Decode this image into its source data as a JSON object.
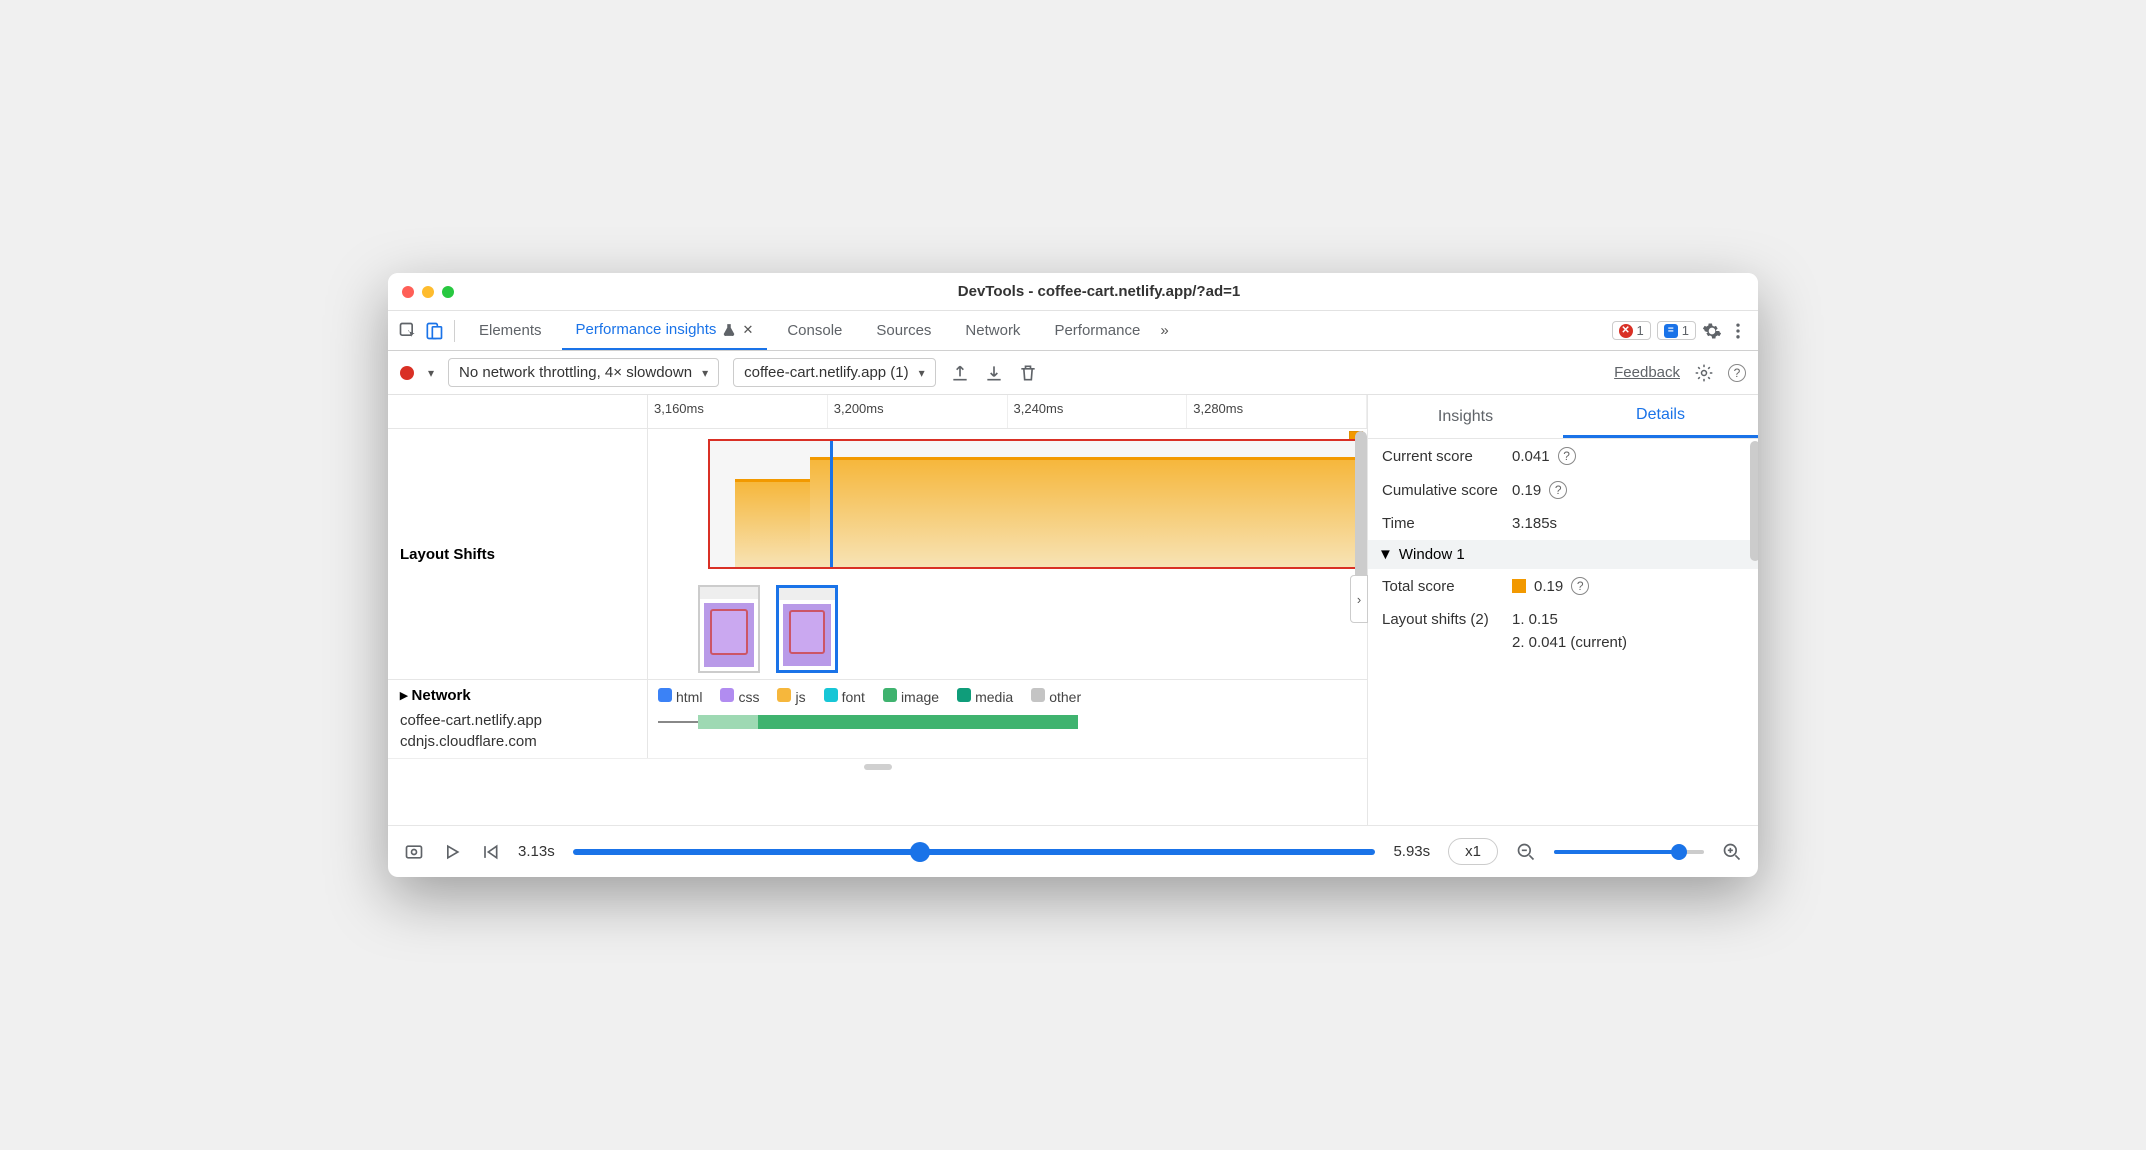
{
  "window": {
    "title": "DevTools - coffee-cart.netlify.app/?ad=1"
  },
  "tabs": {
    "elements": "Elements",
    "perf_insights": "Performance insights",
    "console": "Console",
    "sources": "Sources",
    "network": "Network",
    "performance": "Performance"
  },
  "badges": {
    "errors": "1",
    "issues": "1"
  },
  "toolbar": {
    "throttle": "No network throttling, 4× slowdown",
    "recording": "coffee-cart.netlify.app (1)",
    "feedback": "Feedback"
  },
  "ruler": {
    "t1": "3,160ms",
    "t2": "3,200ms",
    "t3": "3,240ms",
    "t4": "3,280ms"
  },
  "layout_shifts": {
    "label": "Layout Shifts"
  },
  "network": {
    "label": "Network",
    "hosts": [
      "coffee-cart.netlify.app",
      "cdnjs.cloudflare.com"
    ],
    "legend": {
      "html": "html",
      "css": "css",
      "js": "js",
      "font": "font",
      "image": "image",
      "media": "media",
      "other": "other"
    },
    "colors": {
      "html": "#3b82f6",
      "css": "#b18cf0",
      "js": "#f6b73c",
      "font": "#17c6d6",
      "image": "#3fb36f",
      "media": "#0f9d7a",
      "other": "#c4c4c4"
    }
  },
  "footer": {
    "start": "3.13s",
    "end": "5.93s",
    "speed": "x1"
  },
  "right": {
    "tabs": {
      "insights": "Insights",
      "details": "Details"
    },
    "current_score": {
      "k": "Current score",
      "v": "0.041"
    },
    "cumulative": {
      "k": "Cumulative score",
      "v": "0.19"
    },
    "time": {
      "k": "Time",
      "v": "3.185s"
    },
    "window_hdr": "Window 1",
    "total_score": {
      "k": "Total score",
      "v": "0.19"
    },
    "shifts": {
      "k": "Layout shifts (2)",
      "v1": "1. 0.15",
      "v2": "2. 0.041 (current)"
    }
  }
}
